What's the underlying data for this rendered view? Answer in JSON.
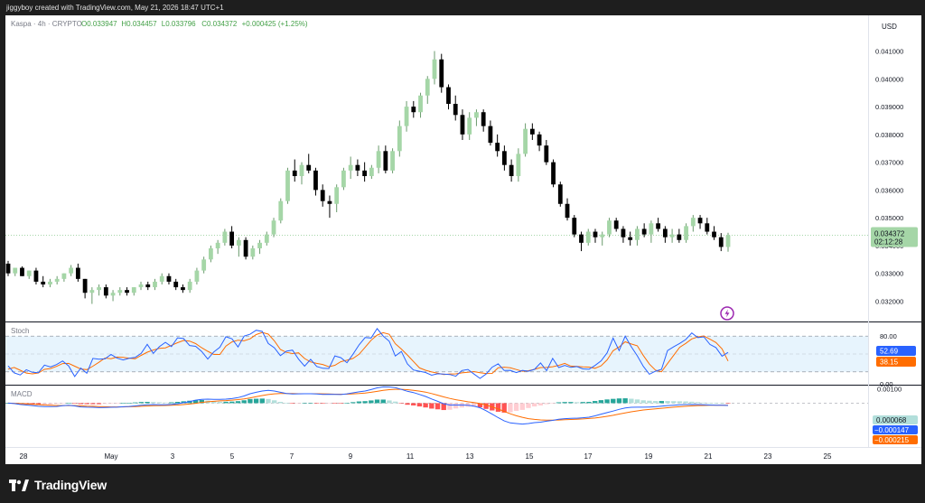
{
  "header": {
    "credit": "jiggyboy created with TradingView.com, May 21, 2026 18:47 UTC+1"
  },
  "legend": {
    "symbol": "Kaspa · 4h · CRYPTO",
    "open": "O0.033947",
    "high": "H0.034457",
    "low": "L0.033796",
    "close": "C0.034372",
    "change": "+0.000425 (+1.25%)"
  },
  "colors": {
    "up": "#a5d6a7",
    "down": "#000000",
    "stoch_k": "#2962ff",
    "stoch_d": "#ff6d00",
    "macd_line": "#2962ff",
    "signal_line": "#ff6d00",
    "hist_pos_strong": "#26a69a",
    "hist_pos_weak": "#b2dfdb",
    "hist_neg_strong": "#ff5252",
    "hist_neg_weak": "#ffcdd2",
    "price_tag": "#a5d6a7"
  },
  "chart_data": [
    {
      "type": "candlestick",
      "name": "Kaspa · 4h · CRYPTO",
      "currency_label": "USD",
      "price_ticks": [
        0.032,
        0.033,
        0.034,
        0.035,
        0.036,
        0.037,
        0.038,
        0.039,
        0.04,
        0.041
      ],
      "price_tick_labels": [
        "0.032000",
        "0.033000",
        "0.034000",
        "0.035000",
        "0.036000",
        "0.037000",
        "0.038000",
        "0.039000",
        "0.040000",
        "0.041000"
      ],
      "ylim": [
        0.0313,
        0.0417
      ],
      "last_price": "0.034372",
      "countdown": "02:12:28",
      "time_labels": [
        "28",
        "May",
        "3",
        "5",
        "7",
        "9",
        "11",
        "13",
        "15",
        "17",
        "19",
        "21",
        "23",
        "25"
      ],
      "candles": [
        [
          0.03335,
          0.03345,
          0.0329,
          0.033
        ],
        [
          0.033,
          0.0332,
          0.0329,
          0.0332
        ],
        [
          0.0332,
          0.03325,
          0.0329,
          0.0329
        ],
        [
          0.0329,
          0.0331,
          0.0328,
          0.0331
        ],
        [
          0.0331,
          0.0332,
          0.0326,
          0.0327
        ],
        [
          0.0327,
          0.0329,
          0.0325,
          0.0326
        ],
        [
          0.0326,
          0.0328,
          0.0325,
          0.0327
        ],
        [
          0.0327,
          0.0329,
          0.0326,
          0.0328
        ],
        [
          0.0328,
          0.033,
          0.0327,
          0.033
        ],
        [
          0.033,
          0.0333,
          0.0329,
          0.0332
        ],
        [
          0.0332,
          0.03335,
          0.0327,
          0.0328
        ],
        [
          0.0328,
          0.0328,
          0.0321,
          0.0323
        ],
        [
          0.0323,
          0.0325,
          0.0319,
          0.0324
        ],
        [
          0.0324,
          0.0326,
          0.0322,
          0.0325
        ],
        [
          0.0325,
          0.0326,
          0.0321,
          0.0322
        ],
        [
          0.0322,
          0.0324,
          0.032,
          0.0323
        ],
        [
          0.0323,
          0.0325,
          0.0322,
          0.0324
        ],
        [
          0.0324,
          0.0325,
          0.0322,
          0.0323
        ],
        [
          0.0323,
          0.0325,
          0.0322,
          0.0325
        ],
        [
          0.0325,
          0.0327,
          0.0324,
          0.0326
        ],
        [
          0.0326,
          0.0327,
          0.0324,
          0.0325
        ],
        [
          0.0325,
          0.0328,
          0.0324,
          0.0327
        ],
        [
          0.0327,
          0.033,
          0.0326,
          0.0329
        ],
        [
          0.0329,
          0.033,
          0.0326,
          0.0327
        ],
        [
          0.0327,
          0.0328,
          0.0324,
          0.0325
        ],
        [
          0.0325,
          0.0326,
          0.0323,
          0.0324
        ],
        [
          0.0324,
          0.0328,
          0.0323,
          0.0327
        ],
        [
          0.0327,
          0.0332,
          0.0326,
          0.0331
        ],
        [
          0.0331,
          0.0336,
          0.033,
          0.0335
        ],
        [
          0.0335,
          0.034,
          0.0334,
          0.0339
        ],
        [
          0.0339,
          0.0342,
          0.0337,
          0.0341
        ],
        [
          0.0341,
          0.0346,
          0.034,
          0.0345
        ],
        [
          0.0345,
          0.0347,
          0.0339,
          0.034
        ],
        [
          0.034,
          0.0343,
          0.0336,
          0.0342
        ],
        [
          0.0342,
          0.0343,
          0.0335,
          0.0336
        ],
        [
          0.0336,
          0.034,
          0.0335,
          0.0339
        ],
        [
          0.0339,
          0.0342,
          0.0337,
          0.0341
        ],
        [
          0.0341,
          0.0345,
          0.034,
          0.0344
        ],
        [
          0.0344,
          0.035,
          0.0343,
          0.0349
        ],
        [
          0.0349,
          0.0357,
          0.0348,
          0.0356
        ],
        [
          0.0356,
          0.0368,
          0.0355,
          0.0367
        ],
        [
          0.0367,
          0.0371,
          0.0363,
          0.0365
        ],
        [
          0.0365,
          0.037,
          0.0362,
          0.0369
        ],
        [
          0.0369,
          0.0373,
          0.0366,
          0.0367
        ],
        [
          0.0367,
          0.0368,
          0.0358,
          0.036
        ],
        [
          0.036,
          0.0362,
          0.0354,
          0.0356
        ],
        [
          0.0356,
          0.0358,
          0.035,
          0.0355
        ],
        [
          0.0355,
          0.0362,
          0.0352,
          0.0361
        ],
        [
          0.0361,
          0.0368,
          0.036,
          0.0367
        ],
        [
          0.0367,
          0.0372,
          0.0364,
          0.0369
        ],
        [
          0.0369,
          0.0371,
          0.0365,
          0.0367
        ],
        [
          0.0367,
          0.037,
          0.0363,
          0.0365
        ],
        [
          0.0365,
          0.0369,
          0.0364,
          0.0368
        ],
        [
          0.0368,
          0.0376,
          0.0366,
          0.0374
        ],
        [
          0.0374,
          0.0376,
          0.0366,
          0.0367
        ],
        [
          0.0367,
          0.0375,
          0.0366,
          0.0374
        ],
        [
          0.0374,
          0.0385,
          0.0372,
          0.0383
        ],
        [
          0.0383,
          0.0392,
          0.0381,
          0.039
        ],
        [
          0.039,
          0.0392,
          0.0386,
          0.0388
        ],
        [
          0.0388,
          0.0395,
          0.0386,
          0.0394
        ],
        [
          0.0394,
          0.0401,
          0.0391,
          0.04
        ],
        [
          0.04,
          0.041,
          0.0398,
          0.0407
        ],
        [
          0.0407,
          0.0409,
          0.0395,
          0.0397
        ],
        [
          0.0397,
          0.0398,
          0.0389,
          0.0391
        ],
        [
          0.0391,
          0.0394,
          0.0385,
          0.0387
        ],
        [
          0.0387,
          0.0389,
          0.0378,
          0.038
        ],
        [
          0.038,
          0.0388,
          0.0378,
          0.0386
        ],
        [
          0.0386,
          0.0389,
          0.0383,
          0.0388
        ],
        [
          0.0388,
          0.0389,
          0.0381,
          0.0383
        ],
        [
          0.0383,
          0.0385,
          0.0376,
          0.0377
        ],
        [
          0.0377,
          0.038,
          0.0372,
          0.0374
        ],
        [
          0.0374,
          0.0376,
          0.0367,
          0.0369
        ],
        [
          0.0369,
          0.0371,
          0.0363,
          0.0365
        ],
        [
          0.0365,
          0.0375,
          0.0363,
          0.0373
        ],
        [
          0.0373,
          0.0384,
          0.0372,
          0.0382
        ],
        [
          0.0382,
          0.0384,
          0.0378,
          0.038
        ],
        [
          0.038,
          0.0381,
          0.0374,
          0.0376
        ],
        [
          0.0376,
          0.0378,
          0.0369,
          0.037
        ],
        [
          0.037,
          0.0371,
          0.0361,
          0.0362
        ],
        [
          0.0362,
          0.0363,
          0.0354,
          0.0355
        ],
        [
          0.0355,
          0.0357,
          0.0349,
          0.035
        ],
        [
          0.035,
          0.0351,
          0.0343,
          0.0344
        ],
        [
          0.0344,
          0.0345,
          0.0338,
          0.0341
        ],
        [
          0.0341,
          0.0346,
          0.034,
          0.0345
        ],
        [
          0.0345,
          0.0346,
          0.0341,
          0.0343
        ],
        [
          0.0343,
          0.0345,
          0.034,
          0.0344
        ],
        [
          0.0344,
          0.035,
          0.0343,
          0.0349
        ],
        [
          0.0349,
          0.035,
          0.0345,
          0.0346
        ],
        [
          0.0346,
          0.0347,
          0.0341,
          0.0343
        ],
        [
          0.0343,
          0.0345,
          0.034,
          0.0342
        ],
        [
          0.0342,
          0.0347,
          0.034,
          0.0346
        ],
        [
          0.0346,
          0.0348,
          0.0343,
          0.0344
        ],
        [
          0.0344,
          0.0349,
          0.0341,
          0.0348
        ],
        [
          0.0348,
          0.035,
          0.0345,
          0.0346
        ],
        [
          0.0346,
          0.0347,
          0.0341,
          0.0343
        ],
        [
          0.0343,
          0.0346,
          0.0341,
          0.0344
        ],
        [
          0.0344,
          0.0346,
          0.0341,
          0.0342
        ],
        [
          0.0342,
          0.0348,
          0.0341,
          0.0347
        ],
        [
          0.0347,
          0.0351,
          0.0345,
          0.035
        ],
        [
          0.035,
          0.0351,
          0.0346,
          0.0348
        ],
        [
          0.0348,
          0.035,
          0.0344,
          0.0345
        ],
        [
          0.0345,
          0.0347,
          0.0342,
          0.0343
        ],
        [
          0.0343,
          0.03445,
          0.0338,
          0.03395
        ],
        [
          0.03395,
          0.03446,
          0.03378,
          0.03437
        ]
      ]
    },
    {
      "type": "line",
      "name": "Stoch",
      "ylim": [
        0,
        100
      ],
      "ticks": [
        0,
        80
      ],
      "tick_labels": [
        "0.00",
        "80.00"
      ],
      "band": [
        20,
        80
      ],
      "midline": 50,
      "k_value": "52.69",
      "d_value": "38.15",
      "k": [
        30.0,
        18.3,
        14.8,
        23.7,
        19.2,
        18.6,
        31.3,
        28.4,
        32.3,
        38.4,
        30.0,
        12.2,
        26.3,
        17.8,
        42.5,
        41.3,
        41.8,
        49.3,
        43.1,
        40.0,
        42.8,
        44.2,
        51.1,
        66.2,
        51.1,
        62.3,
        69.6,
        62.5,
        77.1,
        75.9,
        64.2,
        62.9,
        54.2,
        41.5,
        53.5,
        61.3,
        78.9,
        75.5,
        61.8,
        80.0,
        83.2,
        89.8,
        87.9,
        67.5,
        60.5,
        47.2,
        54.7,
        56.5,
        41.4,
        29.5,
        41.0,
        29.1,
        26.1,
        25.6,
        46.8,
        43.8,
        35.3,
        49.7,
        65.3,
        77.6,
        76.8,
        92.5,
        80.2,
        71.4,
        46.7,
        54.3,
        33.4,
        23.2,
        21.0,
        19.0,
        14.4,
        16.8,
        16.4,
        15.6,
        12.8,
        22.2,
        24.1,
        16.3,
        9.1,
        16.4,
        27.9,
        33.5,
        22.3,
        22.5,
        18.8,
        22.6,
        21.0,
        24.2,
        35.0,
        22.0,
        42.5,
        27.3,
        30.7,
        27.6,
        29.0,
        25.0,
        24.4,
        30.7,
        38.4,
        51.9,
        76.7,
        55.6,
        79.9,
        62.3,
        46.9,
        29.3,
        16.1,
        21.1,
        24.2,
        55.7,
        61.9,
        67.8,
        74.3,
        85.3,
        77.4,
        78.8,
        66.1,
        60.8,
        46.3,
        52.7
      ],
      "d": [
        24.5,
        27.5,
        22.8,
        18.1,
        16.6,
        18.2,
        24.2,
        25.6,
        29.2,
        33.9,
        34.3,
        29.6,
        24.9,
        23.8,
        29.5,
        36.1,
        43.2,
        42.1,
        44.9,
        44.3,
        43.1,
        42.0,
        47.8,
        53.0,
        56.6,
        59.5,
        60.3,
        64.5,
        69.0,
        72.8,
        71.7,
        67.4,
        60.5,
        54.6,
        49.3,
        49.3,
        63.4,
        70.3,
        73.2,
        72.1,
        75.4,
        82.6,
        86.2,
        83.3,
        72.1,
        57.6,
        52.7,
        50.8,
        52.0,
        42.4,
        36.7,
        34.3,
        32.5,
        28.6,
        31.1,
        37.1,
        39.6,
        42.5,
        49.6,
        61.2,
        73.0,
        81.7,
        85.8,
        83.1,
        67.2,
        58.4,
        48.3,
        37.5,
        26.6,
        22.8,
        19.9,
        17.8,
        15.4,
        16.5,
        16.6,
        18.3,
        19.2,
        20.5,
        18.5,
        17.3,
        17.4,
        27.0,
        27.9,
        26.8,
        24.0,
        21.1,
        21.9,
        24.2,
        27.3,
        27.5,
        28.6,
        30.9,
        34.2,
        29.7,
        29.3,
        28.4,
        28.1,
        26.1,
        30.2,
        40.2,
        55.5,
        61.8,
        70.4,
        66.8,
        63.8,
        47.4,
        33.1,
        23.1,
        20.2,
        33.9,
        47.6,
        61.2,
        67.8,
        75.3,
        78.6,
        80.3,
        74.8,
        69.2,
        58.6,
        38.15
      ]
    },
    {
      "type": "line",
      "name": "MACD",
      "ylim": [
        -0.0003,
        0.00011
      ],
      "ticks": [
        0.0001
      ],
      "tick_labels": [
        "0.00100"
      ],
      "hist_value": "0.000068",
      "macd_value": "−0.000147",
      "signal_value": "−0.000215",
      "macd": [
        0.0,
        -3e-06,
        -9e-06,
        -1.3e-05,
        -1.7e-05,
        -2.2e-05,
        -2.4e-05,
        -2.4e-05,
        -2.3e-05,
        -1.8e-05,
        -1.5e-05,
        -1.9e-05,
        -2.6e-05,
        -2.8e-05,
        -2.9e-05,
        -3.1e-05,
        -3e-05,
        -2.9e-05,
        -2.8e-05,
        -2.5e-05,
        -2.3e-05,
        -1.9e-05,
        -1.4e-05,
        -1.1e-05,
        -1e-05,
        -1.1e-05,
        -1.2e-05,
        -9e-06,
        -4e-06,
        3e-06,
        1.1e-05,
        2.1e-05,
        2.7e-05,
        2.8e-05,
        2.6e-05,
        2.6e-05,
        2.8e-05,
        3.2e-05,
        3.9e-05,
        5e-05,
        6.6e-05,
        7.6e-05,
        8.5e-05,
        8.9e-05,
        8.5e-05,
        7.6e-05,
        6.8e-05,
        6.4e-05,
        6.5e-05,
        6.6e-05,
        6.6e-05,
        6.4e-05,
        6.1e-05,
        6.2e-05,
        6.1e-05,
        6e-05,
        6.5e-05,
        7.2e-05,
        7.9e-05,
        8.5e-05,
        9.5e-05,
        0.000107,
        0.000114,
        0.000113,
        0.000108,
        9.6e-05,
        8.3e-05,
        7.4e-05,
        6.1e-05,
        4.7e-05,
        2.9e-05,
        1.3e-05,
        -4e-06,
        -1.3e-05,
        -1.3e-05,
        -1.3e-05,
        -1.5e-05,
        -2.1e-05,
        -3.2e-05,
        -5.3e-05,
        -7.7e-05,
        -0.000101,
        -0.000124,
        -0.000138,
        -0.000142,
        -0.000146,
        -0.000142,
        -0.000136,
        -0.000133,
        -0.000126,
        -0.00012,
        -0.000112,
        -0.000108,
        -0.000106,
        -0.000105,
        -0.000102,
        -9.8e-05,
        -8.9e-05,
        -7.7e-05,
        -6.6e-05,
        -5.5e-05,
        -4.3e-05,
        -3.4e-05,
        -2.9e-05,
        -2.8e-05,
        -2.8e-05,
        -2.7e-05,
        -2.5e-05,
        -2.1e-05,
        -1.7e-05,
        -1.4e-05,
        -1.2e-05,
        -1e-05,
        -9e-06,
        -1e-05,
        -1.2e-05,
        -1.3e-05,
        -1.4e-05,
        -1.5e-05,
        -1.6e-05
      ],
      "signal": [
        0.0,
        -1e-06,
        -3e-06,
        -5e-06,
        -8e-06,
        -1e-05,
        -1.3e-05,
        -1.5e-05,
        -1.7e-05,
        -1.7e-05,
        -1.7e-05,
        -1.7e-05,
        -1.9e-05,
        -2.1e-05,
        -2.2e-05,
        -2.4e-05,
        -2.5e-05,
        -2.6e-05,
        -2.6e-05,
        -2.6e-05,
        -2.5e-05,
        -2.4e-05,
        -2.2e-05,
        -2e-05,
        -1.8e-05,
        -1.7e-05,
        -1.6e-05,
        -1.5e-05,
        -1.3e-05,
        -1e-05,
        -6e-06,
        -1e-06,
        5e-06,
        1e-05,
        1.3e-05,
        1.6e-05,
        1.8e-05,
        2.1e-05,
        2.5e-05,
        3e-05,
        3.7e-05,
        4.5e-05,
        5.3e-05,
        6e-05,
        6.5e-05,
        6.7e-05,
        6.7e-05,
        6.7e-05,
        6.6e-05,
        6.6e-05,
        6.6e-05,
        6.6e-05,
        6.5e-05,
        6.4e-05,
        6.3e-05,
        6.3e-05,
        6.3e-05,
        6.5e-05,
        6.7e-05,
        7.1e-05,
        7.6e-05,
        8.2e-05,
        8.9e-05,
        9.4e-05,
        9.7e-05,
        9.7e-05,
        9.4e-05,
        9e-05,
        8.4e-05,
        7.7e-05,
        6.7e-05,
        5.6e-05,
        4.4e-05,
        3.3e-05,
        2.4e-05,
        1.7e-05,
        1e-05,
        4e-06,
        -3e-06,
        -1.3e-05,
        -2.6e-05,
        -4.1e-05,
        -5.8e-05,
        -7.4e-05,
        -8.8e-05,
        -9.9e-05,
        -0.000108,
        -0.000113,
        -0.000117,
        -0.000119,
        -0.000119,
        -0.000118,
        -0.000116,
        -0.000114,
        -0.000112,
        -0.00011,
        -0.000107,
        -0.000104,
        -9.8e-05,
        -9.2e-05,
        -8.5e-05,
        -7.6e-05,
        -6.8e-05,
        -6e-05,
        -5.4e-05,
        -4.8e-05,
        -4.4e-05,
        -4e-05,
        -3.6e-05,
        -3.2e-05,
        -2.8e-05,
        -2.5e-05,
        -2.2e-05,
        -1.9e-05,
        -1.7e-05,
        -1.6e-05,
        -1.5e-05,
        -1.5e-05,
        -1.5e-05,
        -1.5e-05
      ]
    }
  ]
}
